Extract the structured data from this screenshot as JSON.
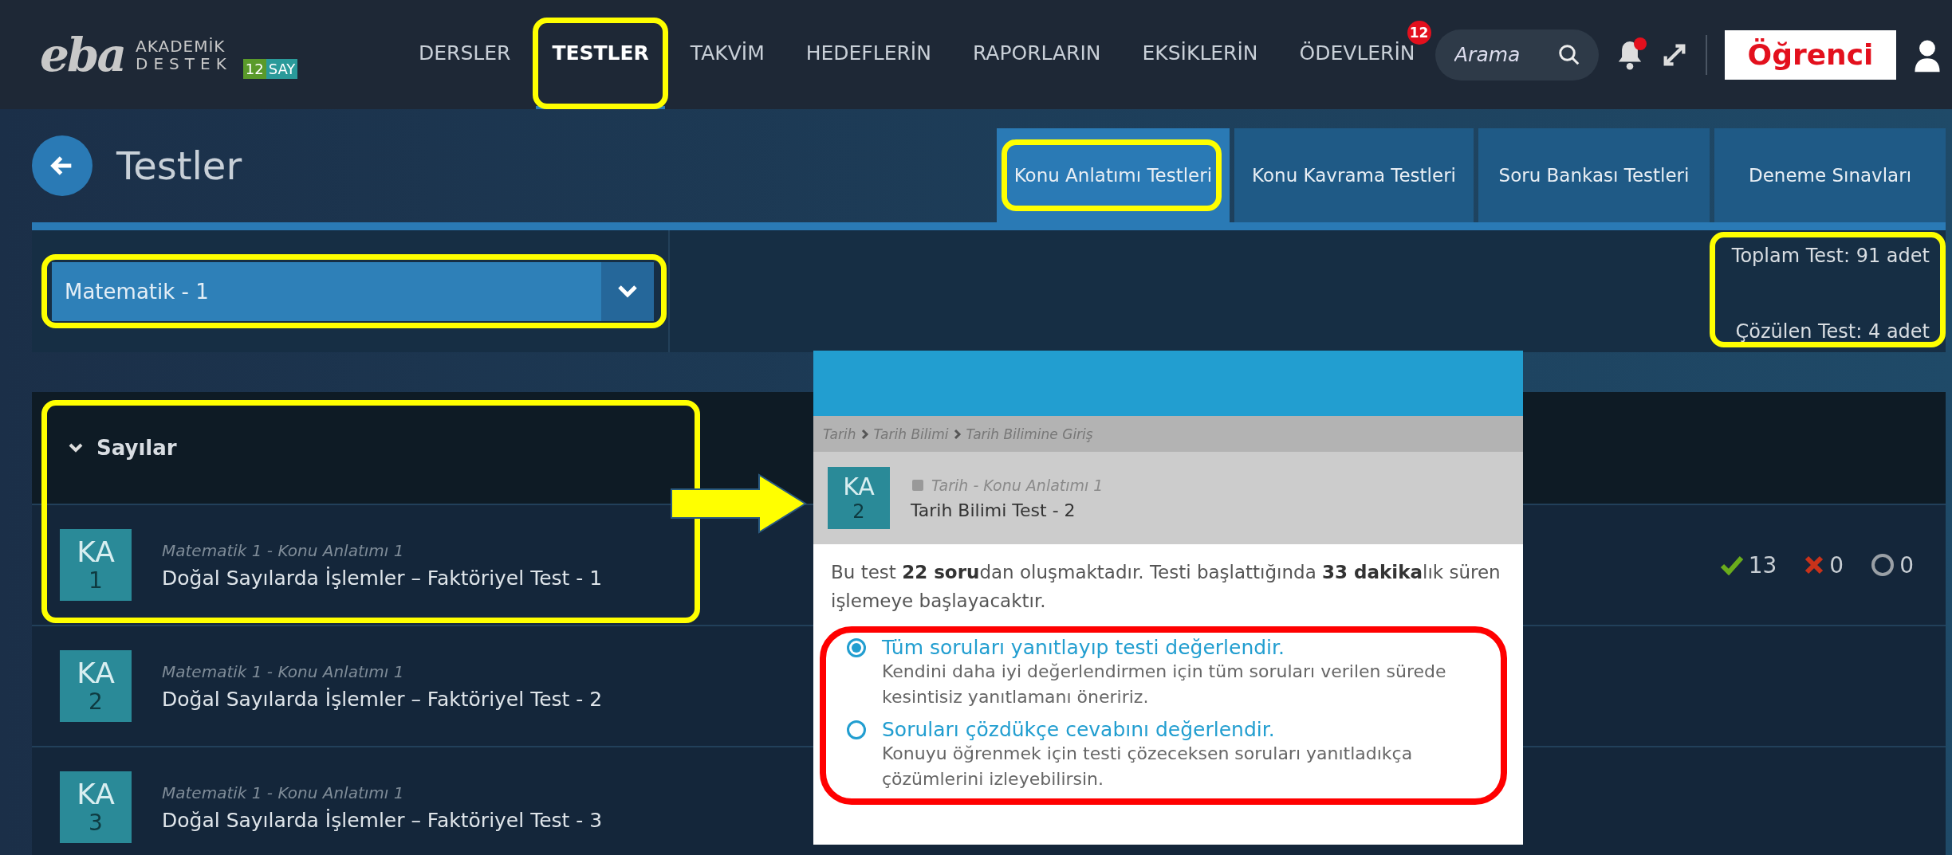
{
  "header": {
    "logo": {
      "mark": "eba",
      "line_1": "AKADEMİK",
      "line_2": "DESTEK",
      "grade": "12",
      "track": "SAY"
    },
    "nav": [
      {
        "label": "DERSLER",
        "selected": false,
        "highlighted": false
      },
      {
        "label": "TESTLER",
        "selected": true,
        "highlighted": true
      },
      {
        "label": "TAKVİM",
        "selected": false,
        "highlighted": false
      },
      {
        "label": "HEDEFLERİN",
        "selected": false,
        "highlighted": false
      },
      {
        "label": "RAPORLARIN",
        "selected": false,
        "highlighted": false
      },
      {
        "label": "EKSİKLERİN",
        "selected": false,
        "highlighted": false
      },
      {
        "label": "ÖDEVLERİN",
        "selected": false,
        "highlighted": false,
        "badge": "12"
      }
    ],
    "search": {
      "placeholder": "Arama"
    },
    "notifications": {
      "unread": true
    },
    "role_label": "Öğrenci"
  },
  "page": {
    "title": "Testler",
    "tabs": [
      {
        "label": "Konu Anlatımı Testleri",
        "selected": true,
        "highlighted": true
      },
      {
        "label": "Konu Kavrama Testleri",
        "selected": false,
        "highlighted": false
      },
      {
        "label": "Soru Bankası Testleri",
        "selected": false,
        "highlighted": false
      },
      {
        "label": "Deneme Sınavları",
        "selected": false,
        "highlighted": false
      }
    ]
  },
  "filter": {
    "subject": "Matematik - 1",
    "highlighted": true,
    "total": "Toplam Test: 91 adet",
    "solved": "Çözülen Test: 4 adet",
    "stats_highlighted": true
  },
  "groups": [
    {
      "title": "Sayılar",
      "expanded": true,
      "highlighted": true,
      "tests": [
        {
          "badge": "KA",
          "number": "1",
          "category": "Matematik 1 - Konu Anlatımı 1",
          "title": "Doğal Sayılarda İşlemler – Faktöriyel Test - 1",
          "results": {
            "correct": "13",
            "wrong": "0",
            "empty": "0"
          }
        },
        {
          "badge": "KA",
          "number": "2",
          "category": "Matematik 1 - Konu Anlatımı 1",
          "title": "Doğal Sayılarda İşlemler – Faktöriyel Test - 2"
        },
        {
          "badge": "KA",
          "number": "3",
          "category": "Matematik 1 - Konu Anlatımı 1",
          "title": "Doğal Sayılarda İşlemler – Faktöriyel Test - 3"
        }
      ]
    }
  ],
  "popup": {
    "breadcrumb": [
      "Tarih",
      "Tarih Bilimi",
      "Tarih Bilimine Giriş"
    ],
    "badge": "KA",
    "number": "2",
    "category": "Tarih - Konu Anlatımı 1",
    "title": "Tarih Bilimi Test - 2",
    "description": "Bu test **22 soru**dan oluşmaktadır. Testi başlattığında **33 dakika**lık süren işlemeye başlayacaktır.",
    "options_highlighted": true,
    "options": [
      {
        "label": "Tüm soruları yanıtlayıp testi değerlendir.",
        "hint": "Kendini daha iyi değerlendirmen için tüm soruları verilen sürede kesintisiz yanıtlamanı öneririz.",
        "selected": true
      },
      {
        "label": "Soruları çözdükçe cevabını değerlendir.",
        "hint": "Konuyu öğrenmek için testi çözeceksen soruları yanıtladıkça çözümlerini izleyebilirsin.",
        "selected": false
      }
    ]
  }
}
